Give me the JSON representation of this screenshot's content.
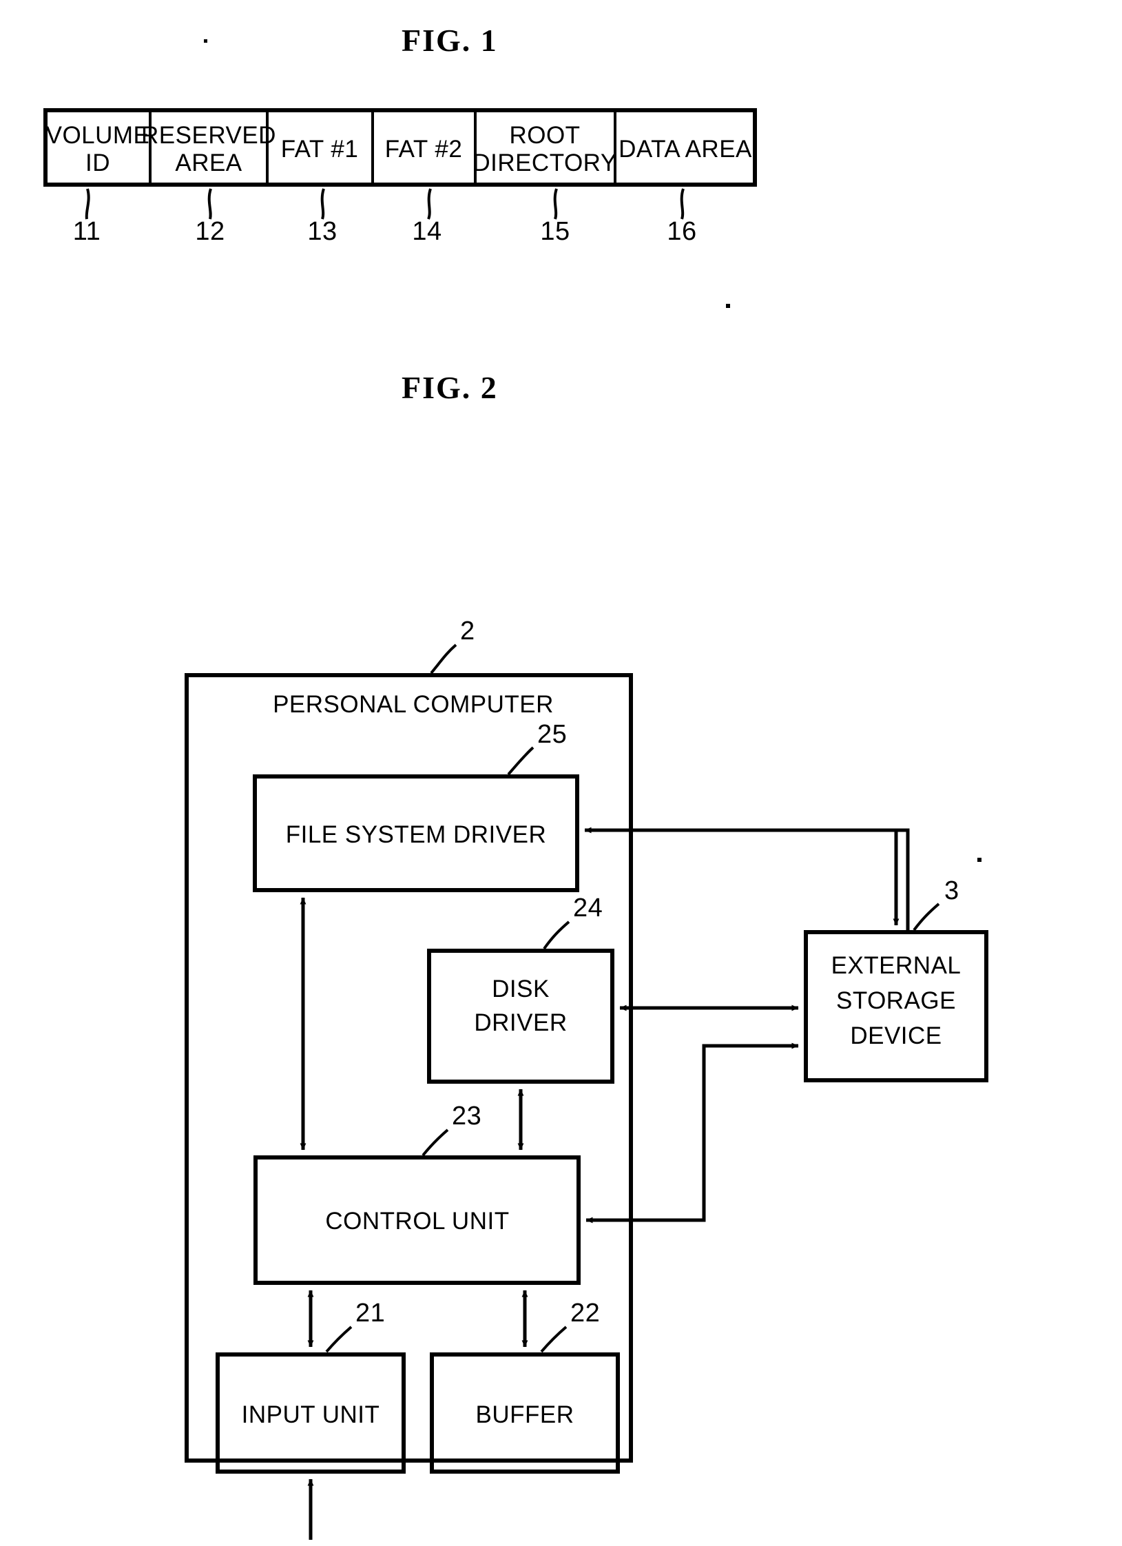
{
  "document": {
    "kind": "patent-drawing-sheet",
    "background_color": "#ffffff",
    "ink_color": "#000000"
  },
  "figure1": {
    "title": "FIG.  1",
    "type": "linear-layout-table",
    "cells": [
      {
        "id": "volume-id",
        "label_lines": [
          "VOLUME",
          "ID"
        ],
        "ref": "11"
      },
      {
        "id": "reserved-area",
        "label_lines": [
          "RESERVED",
          "AREA"
        ],
        "ref": "12"
      },
      {
        "id": "fat-1",
        "label_lines": [
          "FAT #1"
        ],
        "ref": "13"
      },
      {
        "id": "fat-2",
        "label_lines": [
          "FAT #2"
        ],
        "ref": "14"
      },
      {
        "id": "root-directory",
        "label_lines": [
          "ROOT",
          "DIRECTORY"
        ],
        "ref": "15"
      },
      {
        "id": "data-area",
        "label_lines": [
          "DATA AREA"
        ],
        "ref": "16"
      }
    ]
  },
  "figure2": {
    "title": "FIG.  2",
    "type": "block-diagram",
    "container": {
      "id": "personal-computer",
      "label": "PERSONAL COMPUTER",
      "ref": "2"
    },
    "blocks": [
      {
        "id": "file-system-driver",
        "label_lines": [
          "FILE SYSTEM DRIVER"
        ],
        "ref": "25"
      },
      {
        "id": "disk-driver",
        "label_lines": [
          "DISK",
          "DRIVER"
        ],
        "ref": "24"
      },
      {
        "id": "control-unit",
        "label_lines": [
          "CONTROL UNIT"
        ],
        "ref": "23"
      },
      {
        "id": "input-unit",
        "label_lines": [
          "INPUT UNIT"
        ],
        "ref": "21"
      },
      {
        "id": "buffer",
        "label_lines": [
          "BUFFER"
        ],
        "ref": "22"
      },
      {
        "id": "external-storage-device",
        "label_lines": [
          "EXTERNAL",
          "STORAGE",
          "DEVICE"
        ],
        "ref": "3"
      }
    ],
    "connections": [
      {
        "from": "external-storage-device",
        "to": "file-system-driver",
        "direction": "single"
      },
      {
        "from": "file-system-driver",
        "to": "control-unit",
        "direction": "double"
      },
      {
        "from": "external-storage-device",
        "to": "disk-driver",
        "direction": "double"
      },
      {
        "from": "disk-driver",
        "to": "control-unit",
        "direction": "double"
      },
      {
        "from": "external-storage-device",
        "to": "control-unit",
        "direction": "single"
      },
      {
        "from": "control-unit",
        "to": "input-unit",
        "direction": "double"
      },
      {
        "from": "control-unit",
        "to": "buffer",
        "direction": "double"
      },
      {
        "from": "external",
        "to": "input-unit",
        "direction": "single"
      },
      {
        "from": "control-unit",
        "to": "external-storage-device",
        "direction": "single"
      }
    ]
  }
}
